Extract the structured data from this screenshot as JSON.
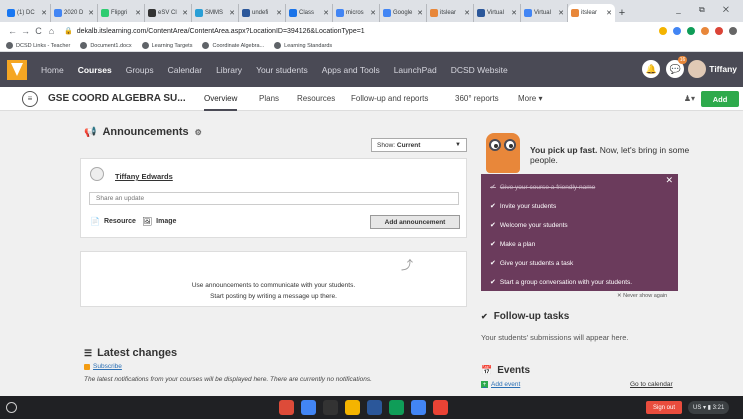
{
  "browser": {
    "tabs": [
      {
        "label": "(1) DC",
        "color": "#1877f2"
      },
      {
        "label": "2020 D",
        "color": "#4285f4"
      },
      {
        "label": "Flipgri",
        "color": "#2ecc71"
      },
      {
        "label": "eSV Cl",
        "color": "#333333"
      },
      {
        "label": "SMMS",
        "color": "#2a9fd6"
      },
      {
        "label": "undefi",
        "color": "#2b579a"
      },
      {
        "label": "Class",
        "color": "#1a73e8"
      },
      {
        "label": "micros",
        "color": "#4285f4"
      },
      {
        "label": "Google",
        "color": "#4285f4"
      },
      {
        "label": "itslear",
        "color": "#e8873a"
      },
      {
        "label": "Virtual",
        "color": "#2b579a"
      },
      {
        "label": "Virtual",
        "color": "#4285f4"
      },
      {
        "label": "itslear",
        "color": "#e8873a",
        "active": true
      }
    ],
    "new_tab": "+",
    "window_controls": "_ ⧉ ✕",
    "back": "←",
    "forward": "→",
    "reload": "C",
    "home": "⌂",
    "url": "dekalb.itslearning.com/ContentArea/ContentArea.aspx?LocationID=394126&LocationType=1",
    "bookmarks": [
      "DCSD Links - Teacher",
      "Document1.docx",
      "Learning Targets",
      "Coordinate Algebra...",
      "Learning Standards"
    ]
  },
  "nav": {
    "items": [
      "Home",
      "Courses",
      "Groups",
      "Calendar",
      "Library",
      "Your students",
      "Apps and Tools",
      "LaunchPad",
      "DCSD Website"
    ],
    "active": "Courses",
    "chat_badge": "16",
    "user": "Tiffany"
  },
  "course": {
    "title": "GSE COORD ALGEBRA SU...",
    "tabs": [
      "Overview",
      "Plans",
      "Resources",
      "Follow-up and reports",
      "360° reports",
      "More ▾"
    ],
    "add_label": "Add"
  },
  "announcements": {
    "title": "Announcements",
    "show_label": "Show:",
    "show_value": "Current",
    "author": "Tiffany Edwards",
    "placeholder": "Share an update",
    "resource_label": "Resource",
    "image_label": "Image",
    "add_button": "Add announcement",
    "empty_line1": "Use announcements to communicate with your students.",
    "empty_line2": "Start posting by writing a message up there."
  },
  "latest": {
    "title": "Latest changes",
    "subscribe": "Subscribe",
    "text": "The latest notifications from your courses will be displayed here. There are currently no notifications."
  },
  "onboarding": {
    "headline_bold": "You pick up fast.",
    "headline_rest": " Now, let's bring in some people.",
    "items": [
      {
        "label": "Give your course a friendly name",
        "done": true
      },
      {
        "label": "Invite your students",
        "done": false
      },
      {
        "label": "Welcome your students",
        "done": false
      },
      {
        "label": "Make a plan",
        "done": false
      },
      {
        "label": "Give your students a task",
        "done": false
      },
      {
        "label": "Start a group conversation with your students.",
        "done": false
      }
    ],
    "never_show": "✕ Never show again"
  },
  "followup": {
    "title": "Follow-up tasks",
    "text": "Your students' submissions will appear here."
  },
  "events": {
    "title": "Events",
    "add": "Add event",
    "goto": "Go to calendar"
  },
  "taskbar": {
    "signout": "Sign out",
    "tray": "US ▾ ▮ 3:21",
    "apps": [
      "#dd4b39",
      "#4285f4",
      "#333333",
      "#f4b400",
      "#2b579a",
      "#0f9d58",
      "#4285f4",
      "#ea4335"
    ]
  }
}
